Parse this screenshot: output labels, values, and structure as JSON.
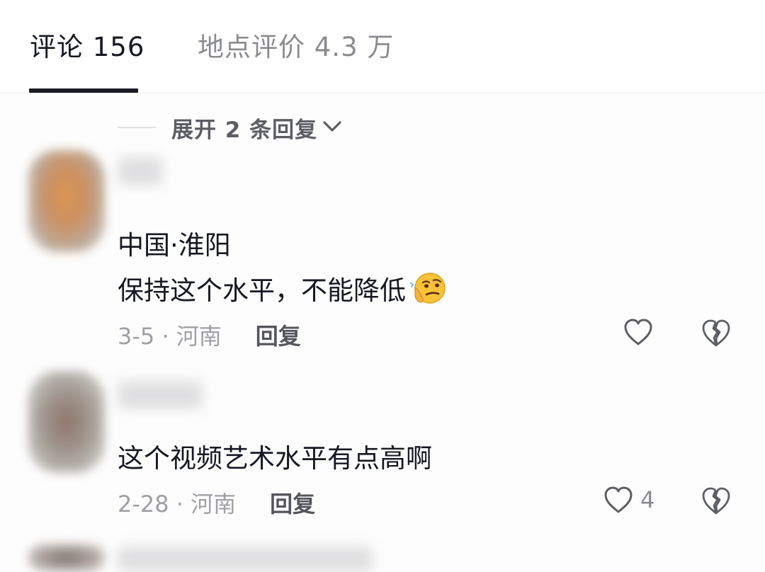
{
  "tabs": {
    "comments_label": "评论 156",
    "place_label": "地点评价 4.3 万",
    "active": "comments"
  },
  "expand": {
    "label": "展开 2 条回复"
  },
  "comments": [
    {
      "location_line": "中国·淮阳",
      "text": "保持这个水平，不能降低",
      "emoji": "thinking-face-emoji",
      "date_region": "3-5 · 河南",
      "reply_label": "回复",
      "like_count": ""
    },
    {
      "text": "这个视频艺术水平有点高啊",
      "date_region": "2-28 · 河南",
      "reply_label": "回复",
      "like_count": "4"
    }
  ],
  "colors": {
    "primary_text": "#161823",
    "secondary_text": "#9fa0a6",
    "tab_inactive": "#8a8b91",
    "indicator": "#1a1a24"
  },
  "icons": [
    "heart-outline-icon",
    "broken-heart-icon",
    "chevron-down-icon",
    "thinking-face-emoji"
  ]
}
